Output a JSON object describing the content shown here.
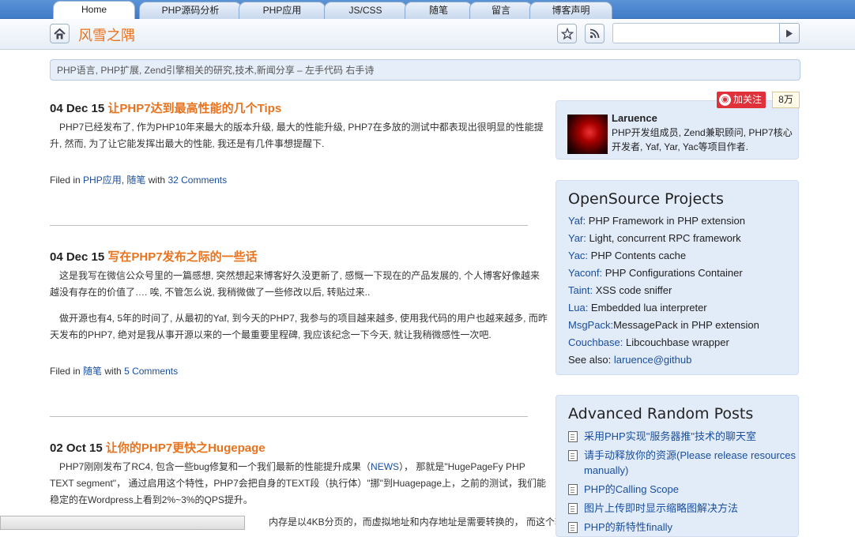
{
  "tabs": [
    "Home",
    "PHP源码分析",
    "PHP应用",
    "JS/CSS",
    "随笔",
    "留言",
    "博客声明"
  ],
  "header": {
    "site_title": "风雪之隅",
    "search_placeholder": ""
  },
  "description": "PHP语言, PHP扩展, Zend引擎相关的研究,技术,新闻分享 – 左手代码 右手诗",
  "posts": [
    {
      "date": "04 Dec 15",
      "title": "让PHP7达到最高性能的几个Tips",
      "body": [
        "PHP7已经发布了, 作为PHP10年来最大的版本升级, 最大的性能升级, PHP7在多放的测试中都表现出很明显的性能提升, 然而, 为了让它能发挥出最大的性能, 我还是有几件事想提醒下."
      ],
      "filed_prefix": "Filed in",
      "cats": [
        "PHP应用",
        "随笔"
      ],
      "with": "with",
      "comments": "32 Comments"
    },
    {
      "date": "04 Dec 15",
      "title": "写在PHP7发布之际的一些话",
      "body": [
        "这是我写在微信公众号里的一篇感想, 突然想起来博客好久没更新了, 感慨一下现在的产品发展的, 个人博客好像越来越没有存在的价值了…. 唉, 不管怎么说, 我稍微做了一些修改以后, 转贴过来..",
        "做开源也有4, 5年的时间了, 从最初的Yaf, 到今天的PHP7, 我参与的项目越来越多, 使用我代码的用户也越来越多, 而昨天发布的PHP7, 绝对是我从事开源以来的一个最重要里程碑, 我应该纪念一下今天, 就让我稍微感性一次吧."
      ],
      "filed_prefix": "Filed in",
      "cats": [
        "随笔"
      ],
      "with": "with",
      "comments": "5 Comments"
    },
    {
      "date": "02 Oct 15",
      "title": "让你的PHP7更快之Hugepage",
      "body_a": "PHP7刚刚发布了RC4, 包含一些bug修复和一个我们最新的性能提升成果（",
      "body_link": "NEWS",
      "body_b": "）， 那就是\"HugePageFy PHP TEXT segment\"， 通过启用这个特性，PHP7会把自身的TEXT段（执行体）\"挪\"到Huagepage上，之前的测试，我们能稳定的在Wordpress上看到2%~3%的QPS提升。",
      "body2": "内存是以4KB分页的，而虚拟地址和内存地址是需要转换的， 而这个转"
    }
  ],
  "sidebar": {
    "weibo": {
      "follow": "加关注",
      "count": "8万"
    },
    "profile": {
      "name": "Laruence",
      "bio": "PHP开发组成员, Zend兼职顾问, PHP7核心开发者, Yaf, Yar, Yac等项目作者."
    },
    "projects_title": "OpenSource Projects",
    "projects": [
      {
        "k": "Yaf:",
        "v": " PHP Framework in PHP extension"
      },
      {
        "k": "Yar:",
        "v": " Light, concurrent RPC framework"
      },
      {
        "k": "Yac:",
        "v": " PHP Contents cache"
      },
      {
        "k": "Yaconf:",
        "v": " PHP Configurations Container"
      },
      {
        "k": "Taint:",
        "v": " XSS code sniffer"
      },
      {
        "k": "Lua:",
        "v": " Embedded lua interpreter"
      },
      {
        "k": "MsgPack:",
        "v": "MessagePack in PHP extension"
      },
      {
        "k": "Couchbase:",
        "v": " Libcouchbase wrapper"
      }
    ],
    "see_also_label": "See also: ",
    "see_also_link": "laruence@github",
    "random_title": "Advanced Random Posts",
    "random_posts": [
      "采用PHP实现\"服务器推\"技术的聊天室",
      "请手动释放你的资源(Please release resources manually)",
      "PHP的Calling Scope",
      "图片上传即时显示缩略图解决方法",
      "PHP的新特性finally"
    ]
  },
  "colors": {
    "accent": "#e8731f",
    "link": "#1a4fa0",
    "sidebar_bg": "#e2ebf8"
  }
}
